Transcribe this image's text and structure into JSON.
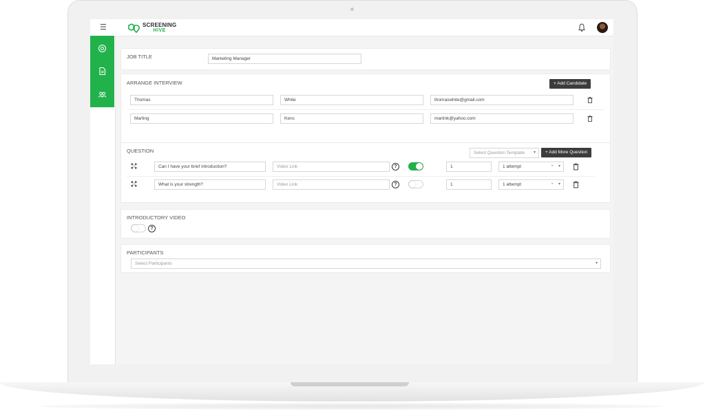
{
  "app": {
    "logo": {
      "line1": "SCREENING",
      "line2": "HIVE"
    },
    "colors": {
      "accent": "#22b24c",
      "dark_button": "#3c3c3c",
      "background": "#f4f4f4"
    }
  },
  "header": {
    "menu_icon": "hamburger-icon",
    "notification_icon": "bell-icon",
    "avatar": "user-avatar"
  },
  "sidebar": {
    "items": [
      {
        "icon": "dashboard-icon"
      },
      {
        "icon": "document-icon"
      },
      {
        "icon": "users-icon"
      }
    ]
  },
  "job": {
    "title_label": "JOB TITLE",
    "title_value": "Marketing Manager"
  },
  "interview": {
    "title": "ARRANGE INTERVIEW",
    "add_candidate": "+ Add Candidate",
    "candidates": [
      {
        "first": "Thomas",
        "last": "White",
        "email": "thomaswhite@gmail.com"
      },
      {
        "first": "Marting",
        "last": "Kens",
        "email": "martink@yahoo.com"
      }
    ]
  },
  "questions": {
    "title": "QUESTION",
    "template_placeholder": "Select Question Template",
    "add_more": "+ Add More Question",
    "video_placeholder": "Video Link",
    "items": [
      {
        "text": "Can I have your brief introduction?",
        "enabled": true,
        "count": "1",
        "attempt": "1 attempt"
      },
      {
        "text": "What is your strength?",
        "enabled": false,
        "count": "1",
        "attempt": "1 attempt"
      }
    ]
  },
  "intro_video": {
    "title": "INTRODUCTORY VIDEO",
    "enabled": false
  },
  "participants": {
    "title": "PARTICIPANTS",
    "placeholder": "Select Participants"
  }
}
